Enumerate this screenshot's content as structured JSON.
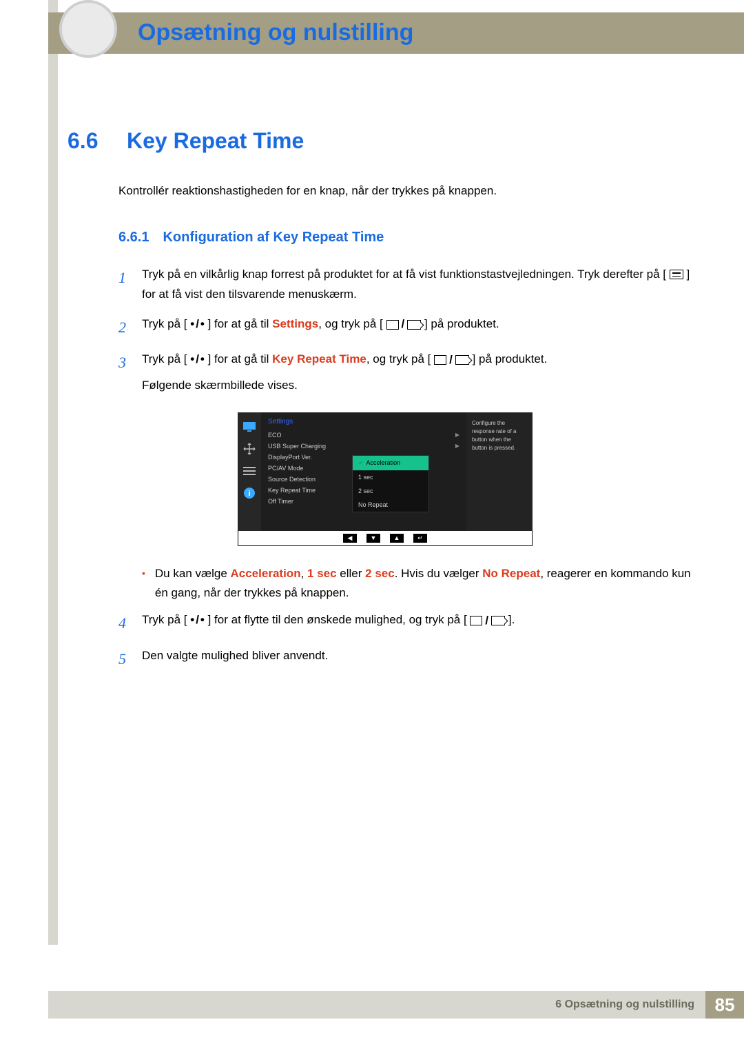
{
  "chapter_title": "Opsætning og nulstilling",
  "section": {
    "num": "6.6",
    "title": "Key Repeat Time"
  },
  "intro": "Kontrollér reaktionshastigheden for en knap, når der trykkes på knappen.",
  "subsection": {
    "num": "6.6.1",
    "title": "Konfiguration af Key Repeat Time"
  },
  "steps": {
    "s1a": "Tryk på en vilkårlig knap forrest på produktet for at få vist funktionstastvejledningen. Tryk derefter på [",
    "s1b": "] for at få vist den tilsvarende menuskærm.",
    "s2a": "Tryk på [",
    "s2b": "] for at gå til ",
    "s2c": "Settings",
    "s2d": ", og tryk på [",
    "s2e": "] på produktet.",
    "s3a": "Tryk på [",
    "s3b": "] for at gå til ",
    "s3c": "Key Repeat Time",
    "s3d": ", og tryk på [",
    "s3e": "] på produktet.",
    "s3f": "Følgende skærmbillede vises.",
    "s4a": "Tryk på [",
    "s4b": "] for at flytte til den ønskede mulighed, og tryk på [",
    "s4c": "].",
    "s5": "Den valgte mulighed bliver anvendt."
  },
  "bullet": {
    "a": "Du kan vælge ",
    "b": "Acceleration",
    "c": ", ",
    "d": "1 sec",
    "e": " eller ",
    "f": "2 sec",
    "g": ". Hvis du vælger ",
    "h": "No Repeat",
    "i": ", reagerer en kommando kun én gang, når der trykkes på knappen."
  },
  "osd": {
    "title": "Settings",
    "items": [
      "ECO",
      "USB Super Charging",
      "DisplayPort Ver.",
      "PC/AV Mode",
      "Source Detection",
      "Key Repeat Time",
      "Off Timer"
    ],
    "submenu": [
      "Acceleration",
      "1 sec",
      "2 sec",
      "No Repeat"
    ],
    "info": "Configure the response rate of a button when the button is pressed."
  },
  "footer": {
    "text": "6 Opsætning og nulstilling",
    "page": "85"
  }
}
